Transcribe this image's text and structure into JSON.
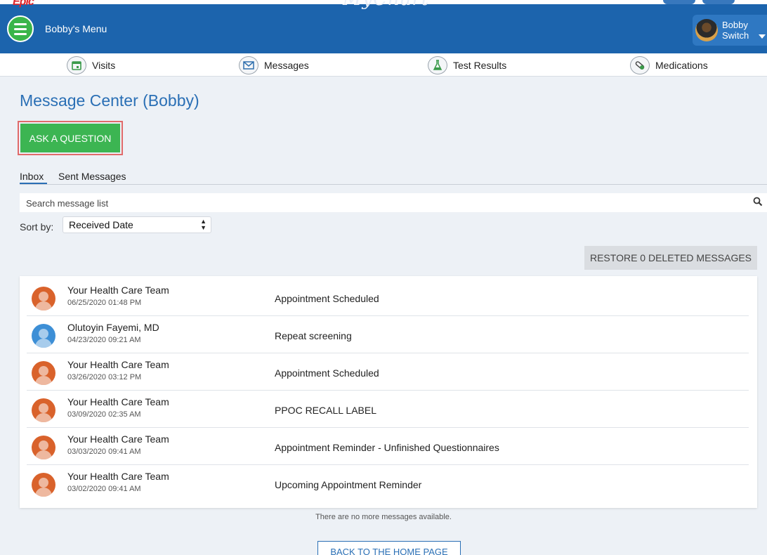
{
  "header": {
    "logo": "Epic",
    "brand": "MyChart",
    "menu_label": "Bobby's Menu",
    "user": {
      "name": "Bobby",
      "switch_label": "Switch"
    }
  },
  "nav": {
    "items": [
      {
        "label": "Visits",
        "icon": "calendar-icon"
      },
      {
        "label": "Messages",
        "icon": "envelope-icon"
      },
      {
        "label": "Test Results",
        "icon": "flask-icon"
      },
      {
        "label": "Medications",
        "icon": "pill-icon"
      }
    ]
  },
  "page": {
    "title": "Message Center (Bobby)",
    "ask_button": "ASK A QUESTION",
    "tabs": [
      "Inbox",
      "Sent Messages"
    ],
    "search_placeholder": "Search message list",
    "sort_label": "Sort by:",
    "sort_value": "Received Date",
    "restore_button": "RESTORE 0 DELETED MESSAGES",
    "no_more": "There are no more messages available.",
    "back_button": "BACK TO THE HOME PAGE"
  },
  "messages": [
    {
      "from": "Your Health Care Team",
      "date": "06/25/2020 01:48 PM",
      "subject": "Appointment Scheduled",
      "avatar_color": "#d9622b"
    },
    {
      "from": "Olutoyin Fayemi, MD",
      "date": "04/23/2020 09:21 AM",
      "subject": "Repeat screening",
      "avatar_color": "#3d8fd6"
    },
    {
      "from": "Your Health Care Team",
      "date": "03/26/2020 03:12 PM",
      "subject": "Appointment Scheduled",
      "avatar_color": "#d9622b"
    },
    {
      "from": "Your Health Care Team",
      "date": "03/09/2020 02:35 AM",
      "subject": "PPOC RECALL LABEL",
      "avatar_color": "#d9622b"
    },
    {
      "from": "Your Health Care Team",
      "date": "03/03/2020 09:41 AM",
      "subject": "Appointment Reminder - Unfinished Questionnaires",
      "avatar_color": "#d9622b"
    },
    {
      "from": "Your Health Care Team",
      "date": "03/02/2020 09:41 AM",
      "subject": "Upcoming Appointment Reminder",
      "avatar_color": "#d9622b"
    }
  ],
  "colors": {
    "header": "#1c64ad",
    "accent": "#2a6fb5",
    "ask_button": "#3cb552",
    "highlight_outline": "#e06a6a"
  }
}
